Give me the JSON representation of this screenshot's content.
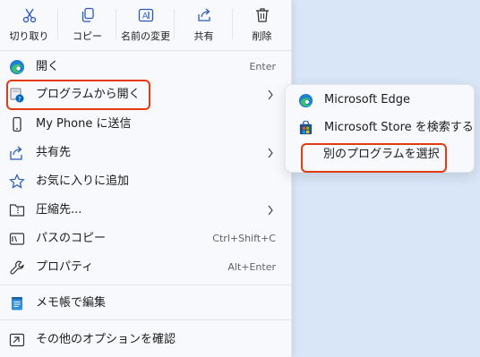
{
  "toolbar": {
    "cut": "切り取り",
    "copy": "コピー",
    "rename": "名前の変更",
    "share": "共有",
    "delete": "削除"
  },
  "menu": {
    "open": {
      "label": "開く",
      "shortcut": "Enter"
    },
    "open_with": {
      "label": "プログラムから開く"
    },
    "phone": {
      "label": "My Phone に送信"
    },
    "share": {
      "label": "共有先"
    },
    "favorites": {
      "label": "お気に入りに追加"
    },
    "compress": {
      "label": "圧縮先..."
    },
    "copy_path": {
      "label": "パスのコピー",
      "shortcut": "Ctrl+Shift+C"
    },
    "properties": {
      "label": "プロパティ",
      "shortcut": "Alt+Enter"
    },
    "notepad": {
      "label": "メモ帳で編集"
    },
    "more_options": {
      "label": "その他のオプションを確認"
    }
  },
  "submenu": {
    "edge": "Microsoft Edge",
    "store": "Microsoft Store を検索する",
    "choose_app": "別のプログラムを選択"
  },
  "colors": {
    "highlight_border": "#e23a12",
    "accent": "#0067c0",
    "background": "#d8e6f7"
  }
}
